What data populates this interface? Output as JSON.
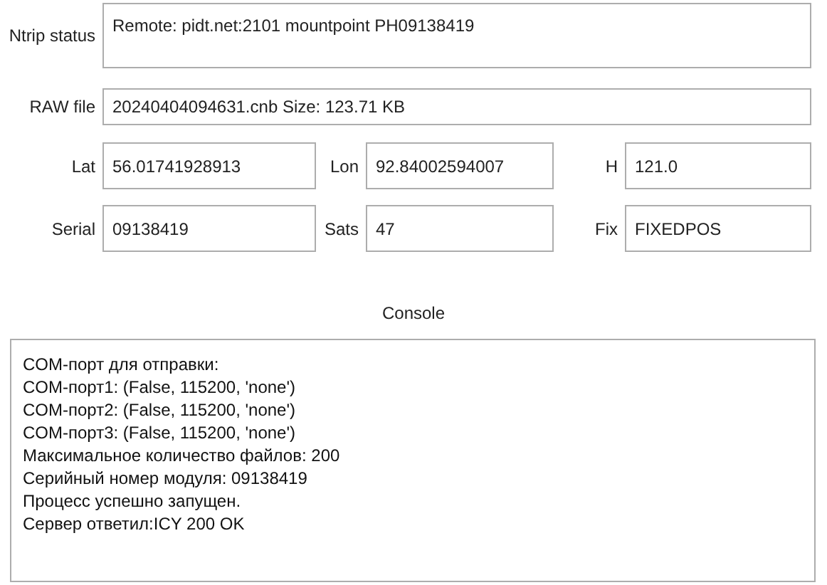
{
  "ntrip_status": {
    "label": "Ntrip status",
    "value": "Remote: pidt.net:2101 mountpoint PH09138419"
  },
  "raw_file": {
    "label": "RAW file",
    "value": "20240404094631.cnb Size: 123.71 KB"
  },
  "fields": [
    {
      "label": "Lat",
      "value": "56.01741928913"
    },
    {
      "label": "Lon",
      "value": "92.84002594007"
    },
    {
      "label": "H",
      "value": "121.0"
    },
    {
      "label": "Serial",
      "value": "09138419"
    },
    {
      "label": "Sats",
      "value": "47"
    },
    {
      "label": "Fix",
      "value": "FIXEDPOS"
    }
  ],
  "console": {
    "title": "Console",
    "lines": [
      "COM-порт для отправки:",
      "COM-порт1: (False, 115200, 'none')",
      "COM-порт2: (False, 115200, 'none')",
      "COM-порт3: (False, 115200, 'none')",
      "Максимальное количество файлов: 200",
      "Серийный номер модуля: 09138419",
      "Процесс успешно запущен.",
      "Сервер ответил:ICY 200 OK"
    ]
  }
}
